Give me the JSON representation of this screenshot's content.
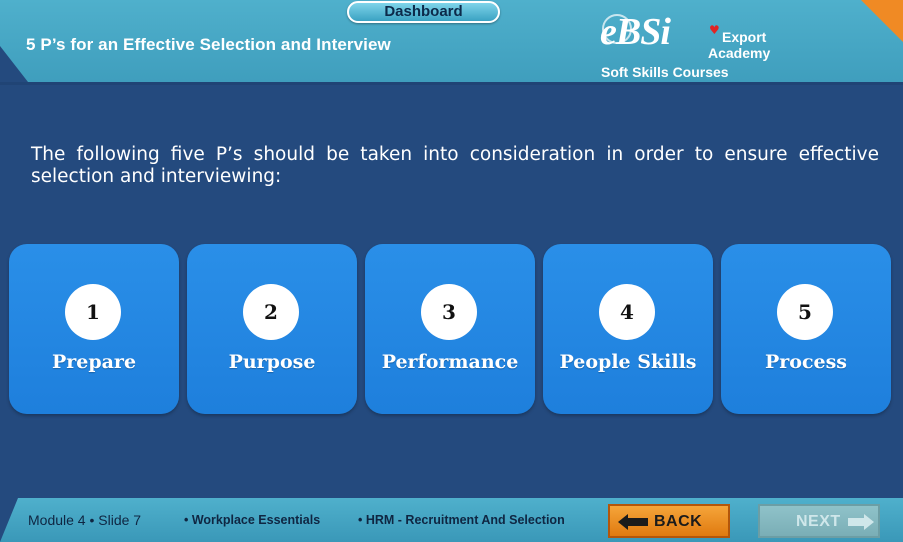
{
  "header": {
    "title": "5 P’s for an Effective Selection and Interview",
    "dashboard_label": "Dashboard"
  },
  "logo": {
    "mark": "eBSi",
    "line1": "Export",
    "line2": "Academy",
    "subtitle": "Soft Skills Courses"
  },
  "main": {
    "intro": "The following five P’s should be taken into consideration in order to ensure effective selection and interviewing:",
    "cards": [
      {
        "number": "1",
        "label": "Prepare"
      },
      {
        "number": "2",
        "label": "Purpose"
      },
      {
        "number": "3",
        "label": "Performance"
      },
      {
        "number": "4",
        "label": "People Skills"
      },
      {
        "number": "5",
        "label": "Process"
      }
    ]
  },
  "footer": {
    "module": "Module 4 • Slide 7",
    "course": "• Workplace Essentials",
    "topic": "• HRM - Recruitment And Selection",
    "back_label": "BACK",
    "next_label": "NEXT"
  },
  "colors": {
    "background": "#244a7e",
    "header": "#4fb0cc",
    "card": "#2a8fe8",
    "back": "#f08a24",
    "next_disabled": "#8fc2c9"
  },
  "icons": {
    "back": "arrow-left-icon",
    "next": "arrow-right-icon"
  }
}
